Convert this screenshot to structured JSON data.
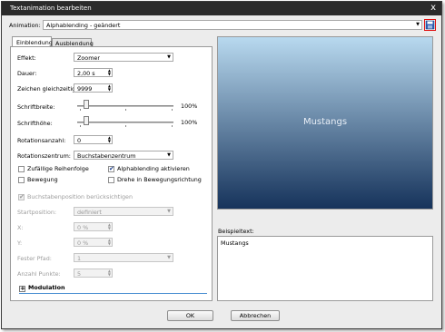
{
  "window": {
    "title": "Textanimation bearbeiten",
    "close_symbol": "x"
  },
  "animation": {
    "label": "Animation:",
    "value": "Alphablending - geändert"
  },
  "tabs": [
    {
      "label": "Einblendung",
      "active": true
    },
    {
      "label": "Ausblendung",
      "active": false
    }
  ],
  "form": {
    "effekt": {
      "label": "Effekt:",
      "value": "Zoomer"
    },
    "dauer": {
      "label": "Dauer:",
      "value": "2,00 s"
    },
    "zeichen": {
      "label": "Zeichen gleichzeitig:",
      "value": "9999"
    },
    "schriftbreite": {
      "label": "Schriftbreite:",
      "value_label": "100%",
      "level_percent": 100
    },
    "schrifthoehe": {
      "label": "Schrifthöhe:",
      "value_label": "100%",
      "level_percent": 100
    },
    "rotationsanzahl": {
      "label": "Rotationsanzahl:",
      "value": "0"
    },
    "rotationszentrum": {
      "label": "Rotationszentrum:",
      "value": "Buchstabenzentrum"
    },
    "checks": [
      {
        "label": "Zufällige Reihenfolge",
        "checked": false
      },
      {
        "label": "Alphablending aktivieren",
        "checked": true
      },
      {
        "label": "Bewegung",
        "checked": false
      },
      {
        "label": "Drehe in Bewegungsrichtung",
        "checked": false
      }
    ],
    "buchstabenposition": {
      "label": "Buchstabenposition berücksichtigen",
      "checked": true
    },
    "startposition": {
      "label": "Startposition:",
      "value": "definiert"
    },
    "x": {
      "label": "X:",
      "value": "0 %"
    },
    "y": {
      "label": "Y:",
      "value": "0 %"
    },
    "fester_pfad": {
      "label": "Fester Pfad:",
      "value": "1"
    },
    "anzahl_punkte": {
      "label": "Anzahl Punkte:",
      "value": "5"
    },
    "modulation": {
      "label": "Modulation",
      "toggle": "+"
    }
  },
  "preview": {
    "text": "Mustangs",
    "gradient_top": "#b8d9ef",
    "gradient_bottom": "#16335b"
  },
  "beispieltext": {
    "label": "Beispieltext:",
    "value": "Mustangs"
  },
  "buttons": {
    "ok": "OK",
    "cancel": "Abbrechen"
  },
  "colors": {
    "save_highlight": "#e01010",
    "save_icon": "#2f63b8"
  }
}
